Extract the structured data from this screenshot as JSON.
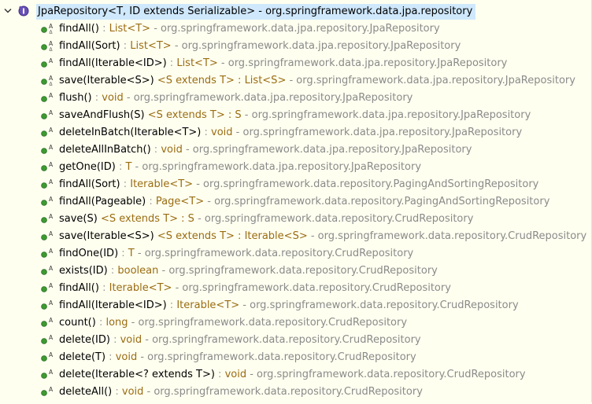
{
  "root": {
    "label": "JpaRepository<T, ID extends Serializable> - org.springframework.data.jpa.repository",
    "icon": "interface-icon",
    "expand_icon": "chevron-down-icon"
  },
  "colors": {
    "background": "#fffff0",
    "selection": "#cfe8fc",
    "method_green": "#3d9a32",
    "signature": "#000000",
    "return_type": "#9a6c12",
    "owner": "#8a8a8a"
  },
  "members": [
    {
      "name": "findAll()",
      "sep": " : ",
      "type": "List<T>",
      "owner": " - org.springframework.data.jpa.repository.JpaRepository",
      "marker": "abstract-generic"
    },
    {
      "name": "findAll(Sort)",
      "sep": " : ",
      "type": "List<T>",
      "owner": " - org.springframework.data.jpa.repository.JpaRepository",
      "marker": "abstract-generic"
    },
    {
      "name": "findAll(Iterable<ID>)",
      "sep": " : ",
      "type": "List<T>",
      "owner": " - org.springframework.data.jpa.repository.JpaRepository",
      "marker": "abstract"
    },
    {
      "name": "save(Iterable<S>)",
      "sep": " ",
      "type": "<S extends T> : List<S>",
      "owner": " - org.springframework.data.jpa.repository.JpaRepository",
      "marker": "abstract-generic"
    },
    {
      "name": "flush()",
      "sep": " : ",
      "type": "void",
      "owner": " - org.springframework.data.jpa.repository.JpaRepository",
      "marker": "abstract"
    },
    {
      "name": "saveAndFlush(S)",
      "sep": " ",
      "type": "<S extends T> : S",
      "owner": " - org.springframework.data.jpa.repository.JpaRepository",
      "marker": "abstract"
    },
    {
      "name": "deleteInBatch(Iterable<T>)",
      "sep": " : ",
      "type": "void",
      "owner": " - org.springframework.data.jpa.repository.JpaRepository",
      "marker": "abstract"
    },
    {
      "name": "deleteAllInBatch()",
      "sep": " : ",
      "type": "void",
      "owner": " - org.springframework.data.jpa.repository.JpaRepository",
      "marker": "abstract"
    },
    {
      "name": "getOne(ID)",
      "sep": " : ",
      "type": "T",
      "owner": " - org.springframework.data.jpa.repository.JpaRepository",
      "marker": "abstract"
    },
    {
      "name": "findAll(Sort)",
      "sep": " : ",
      "type": "Iterable<T>",
      "owner": " - org.springframework.data.repository.PagingAndSortingRepository",
      "marker": "abstract"
    },
    {
      "name": "findAll(Pageable)",
      "sep": " : ",
      "type": "Page<T>",
      "owner": " - org.springframework.data.repository.PagingAndSortingRepository",
      "marker": "abstract"
    },
    {
      "name": "save(S)",
      "sep": " ",
      "type": "<S extends T> : S",
      "owner": " - org.springframework.data.repository.CrudRepository",
      "marker": "abstract"
    },
    {
      "name": "save(Iterable<S>)",
      "sep": " ",
      "type": "<S extends T> : Iterable<S>",
      "owner": " - org.springframework.data.repository.CrudRepository",
      "marker": "abstract"
    },
    {
      "name": "findOne(ID)",
      "sep": " : ",
      "type": "T",
      "owner": " - org.springframework.data.repository.CrudRepository",
      "marker": "abstract"
    },
    {
      "name": "exists(ID)",
      "sep": " : ",
      "type": "boolean",
      "owner": " - org.springframework.data.repository.CrudRepository",
      "marker": "abstract"
    },
    {
      "name": "findAll()",
      "sep": " : ",
      "type": "Iterable<T>",
      "owner": " - org.springframework.data.repository.CrudRepository",
      "marker": "abstract"
    },
    {
      "name": "findAll(Iterable<ID>)",
      "sep": " : ",
      "type": "Iterable<T>",
      "owner": " - org.springframework.data.repository.CrudRepository",
      "marker": "abstract"
    },
    {
      "name": "count()",
      "sep": " : ",
      "type": "long",
      "owner": " - org.springframework.data.repository.CrudRepository",
      "marker": "abstract"
    },
    {
      "name": "delete(ID)",
      "sep": " : ",
      "type": "void",
      "owner": " - org.springframework.data.repository.CrudRepository",
      "marker": "abstract"
    },
    {
      "name": "delete(T)",
      "sep": " : ",
      "type": "void",
      "owner": " - org.springframework.data.repository.CrudRepository",
      "marker": "abstract"
    },
    {
      "name": "delete(Iterable<? extends T>)",
      "sep": " : ",
      "type": "void",
      "owner": " - org.springframework.data.repository.CrudRepository",
      "marker": "abstract"
    },
    {
      "name": "deleteAll()",
      "sep": " : ",
      "type": "void",
      "owner": " - org.springframework.data.repository.CrudRepository",
      "marker": "abstract"
    }
  ]
}
